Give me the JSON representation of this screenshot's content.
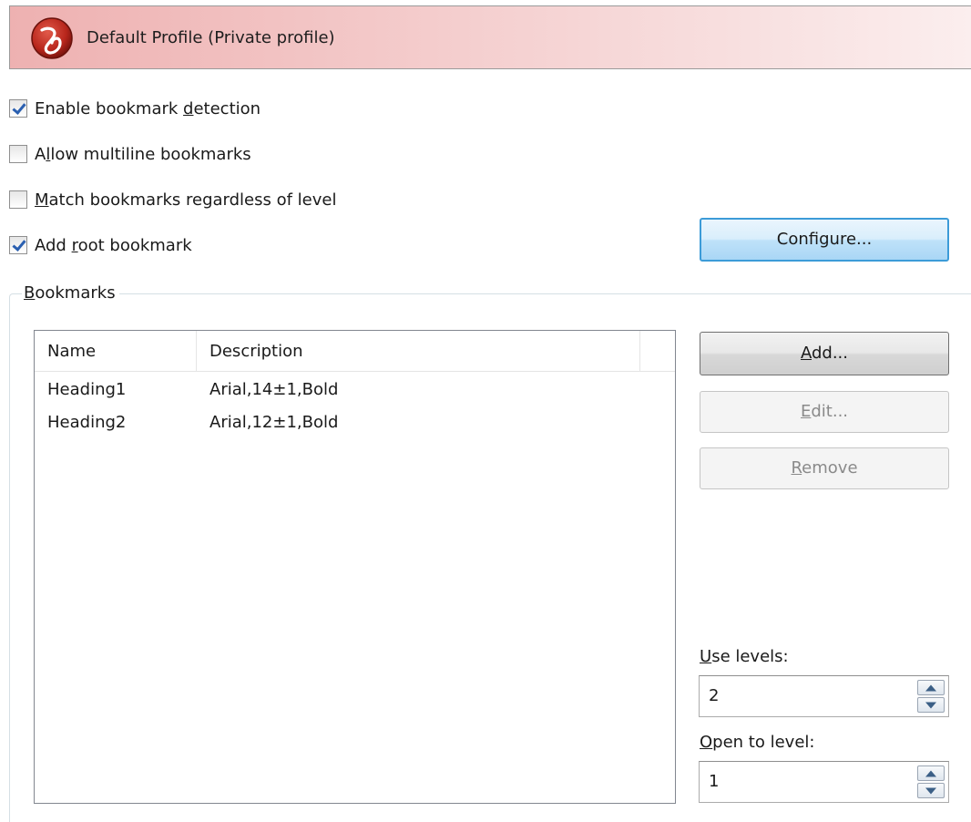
{
  "profile": {
    "title": "Default Profile (Private profile)",
    "icon": "app-logo-icon",
    "header_color": "#eeb1b1"
  },
  "checkboxes": [
    {
      "pre": "Enable bookmark ",
      "mnemonic": "d",
      "post": "etection",
      "checked": true
    },
    {
      "pre": "A",
      "mnemonic": "l",
      "post": "low multiline bookmarks",
      "checked": false
    },
    {
      "pre": "",
      "mnemonic": "M",
      "post": "atch bookmarks regardless of level",
      "checked": false
    },
    {
      "pre": "Add ",
      "mnemonic": "r",
      "post": "oot bookmark",
      "checked": true
    }
  ],
  "buttons": {
    "configure": "Configure...",
    "add": {
      "mnemonic": "A",
      "rest": "dd..."
    },
    "edit": {
      "mnemonic": "E",
      "rest": "dit..."
    },
    "remove": {
      "mnemonic": "R",
      "rest": "emove"
    }
  },
  "bookmarks_group": {
    "mnemonic": "B",
    "rest": "ookmarks"
  },
  "list": {
    "columns": [
      "Name",
      "Description"
    ],
    "rows": [
      {
        "name": "Heading1",
        "description": "Arial,14±1,Bold"
      },
      {
        "name": "Heading2",
        "description": "Arial,12±1,Bold"
      }
    ]
  },
  "use_levels": {
    "label_mnemonic": "U",
    "label_rest": "se levels:",
    "value": "2"
  },
  "open_to_level": {
    "label_mnemonic": "O",
    "label_rest": "pen to level:",
    "value": "1"
  },
  "colors": {
    "accent_border": "#3c9bd8",
    "checkmark": "#2a5fb0"
  }
}
